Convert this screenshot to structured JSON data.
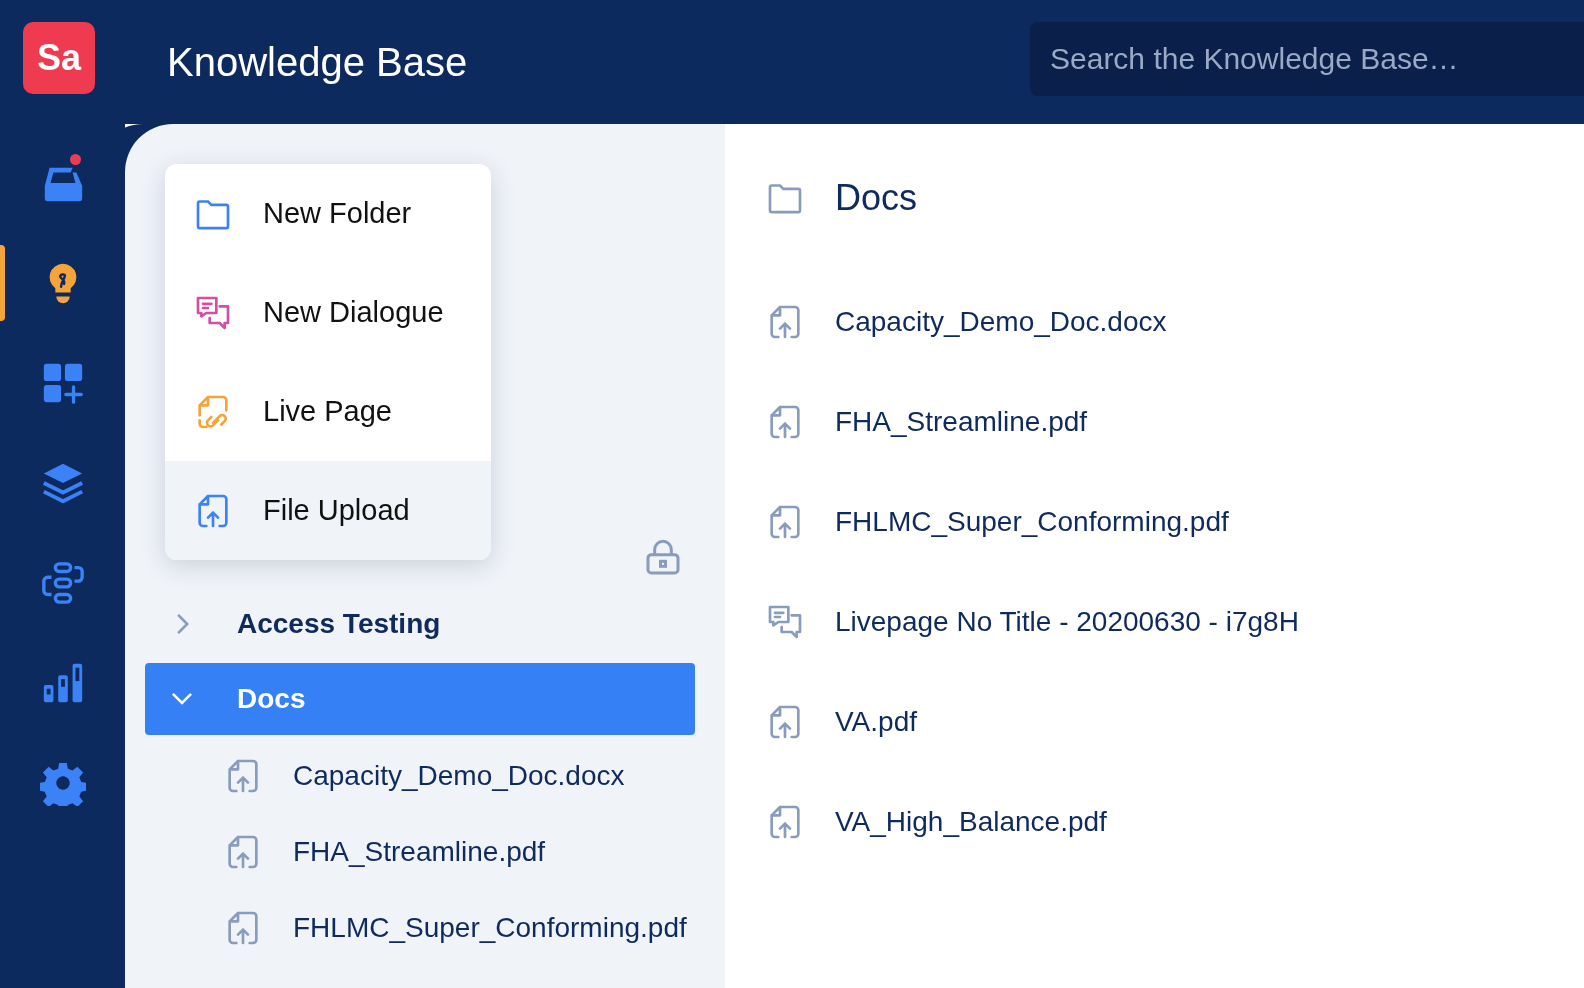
{
  "app": {
    "logo": "Sa",
    "title": "Knowledge Base"
  },
  "search": {
    "placeholder": "Search the Knowledge Base…"
  },
  "nav": [
    {
      "kind": "inbox",
      "selected": false,
      "notification": true
    },
    {
      "kind": "bulb",
      "selected": true,
      "notification": false
    },
    {
      "kind": "apps",
      "selected": false,
      "notification": false
    },
    {
      "kind": "layers",
      "selected": false,
      "notification": false
    },
    {
      "kind": "flow",
      "selected": false,
      "notification": false
    },
    {
      "kind": "chart",
      "selected": false,
      "notification": false
    },
    {
      "kind": "gear",
      "selected": false,
      "notification": false
    }
  ],
  "menu": {
    "items": [
      {
        "kind": "folder",
        "label": "New Folder",
        "selected": false
      },
      {
        "kind": "dialogue",
        "label": "New Dialogue",
        "selected": false
      },
      {
        "kind": "livepage",
        "label": "Live Page",
        "selected": false
      },
      {
        "kind": "upload",
        "label": "File Upload",
        "selected": true
      }
    ]
  },
  "tree": [
    {
      "label": "Access Testing",
      "expanded": false,
      "selected": false
    },
    {
      "label": "Docs",
      "expanded": true,
      "selected": true,
      "children": [
        {
          "kind": "upload",
          "label": "Capacity_Demo_Doc.docx"
        },
        {
          "kind": "upload",
          "label": "FHA_Streamline.pdf"
        },
        {
          "kind": "upload",
          "label": "FHLMC_Super_Conforming.pdf"
        }
      ]
    }
  ],
  "content": {
    "title": "Docs",
    "items": [
      {
        "kind": "upload",
        "label": "Capacity_Demo_Doc.docx"
      },
      {
        "kind": "upload",
        "label": "FHA_Streamline.pdf"
      },
      {
        "kind": "upload",
        "label": "FHLMC_Super_Conforming.pdf"
      },
      {
        "kind": "dialogue",
        "label": "Livepage No Title - 20200630 - i7g8H"
      },
      {
        "kind": "upload",
        "label": "VA.pdf"
      },
      {
        "kind": "upload",
        "label": "VA_High_Balance.pdf"
      }
    ]
  }
}
